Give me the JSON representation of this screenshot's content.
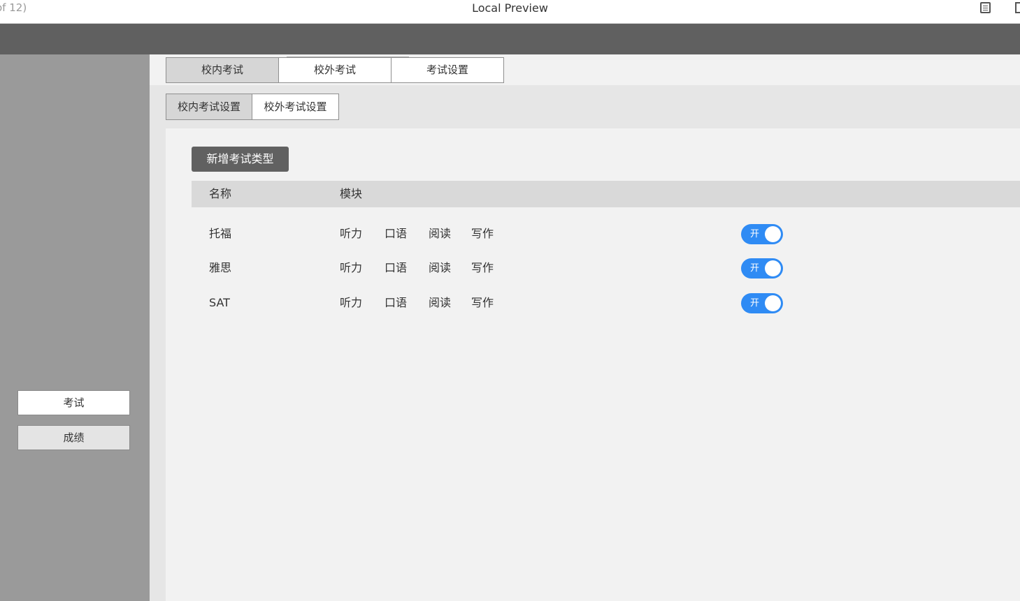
{
  "window": {
    "title": "Local Preview",
    "page_counter": "of 12)"
  },
  "sidebar": {
    "items": [
      {
        "label": "考试",
        "active": true
      },
      {
        "label": "成绩",
        "active": false
      }
    ]
  },
  "tabs": [
    {
      "label": "校内考试",
      "active": true
    },
    {
      "label": "校外考试",
      "active": false
    },
    {
      "label": "考试设置",
      "active": false
    }
  ],
  "subtabs": [
    {
      "label": "校内考试设置",
      "active": true
    },
    {
      "label": "校外考试设置",
      "active": false
    }
  ],
  "add_button": "新增考试类型",
  "table": {
    "headers": {
      "name": "名称",
      "modules": "模块"
    },
    "rows": [
      {
        "name": "托福",
        "modules": [
          "听力",
          "口语",
          "阅读",
          "写作"
        ],
        "toggle": {
          "label": "开",
          "on": true
        }
      },
      {
        "name": "雅思",
        "modules": [
          "听力",
          "口语",
          "阅读",
          "写作"
        ],
        "toggle": {
          "label": "开",
          "on": true
        }
      },
      {
        "name": "SAT",
        "modules": [
          "听力",
          "口语",
          "阅读",
          "写作"
        ],
        "toggle": {
          "label": "开",
          "on": true
        }
      }
    ]
  },
  "colors": {
    "accent": "#2f8bf4",
    "topbar": "#606060",
    "sidebar": "#9a9a9a"
  }
}
